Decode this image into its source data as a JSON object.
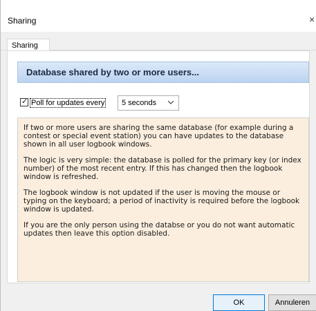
{
  "window": {
    "title": "Sharing",
    "close_glyph": "×"
  },
  "tabs": [
    {
      "label": "Sharing",
      "selected": true
    }
  ],
  "panel": {
    "header": "Database shared by two or more users...",
    "poll_checkbox": {
      "label": "Poll for updates every",
      "checked": true
    },
    "interval_select": {
      "value": "5 seconds"
    },
    "info_paragraphs": [
      "If two or more users are sharing the same database (for example during a contest or special event station) you can have updates to the database shown in all user logbook windows.",
      "The logic is very simple: the database is polled for the primary key (or index number) of the most recent entry. If this has changed then the logbook window is refreshed.",
      "The logbook window is not updated if the user is moving the mouse or typing on the keyboard; a period of inactivity is required before the logbook window is updated.",
      "If you are the only person using the databse or you do not want automatic updates then leave this option disabled."
    ]
  },
  "buttons": {
    "ok": "OK",
    "cancel": "Annuleren"
  },
  "colors": {
    "header_band": "#bcd3ef",
    "info_background": "#fbeede",
    "dialog_background": "#f0f0f0"
  },
  "icons": {
    "close": "close-icon",
    "dropdown": "chevron-down-icon",
    "check": "check-icon"
  }
}
